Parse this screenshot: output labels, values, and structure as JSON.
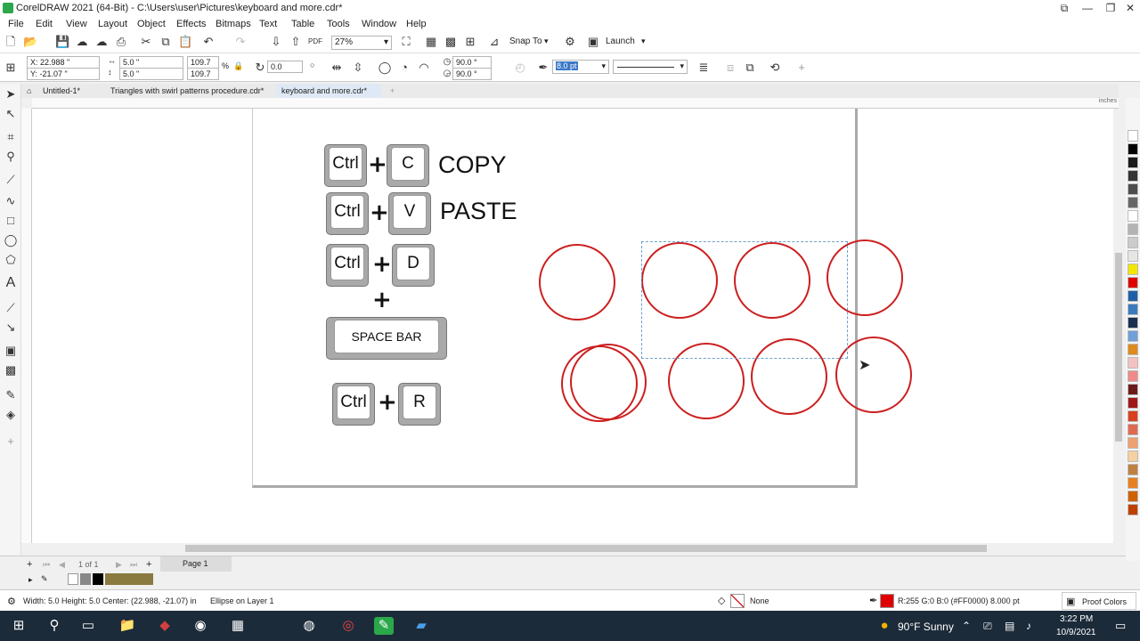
{
  "window": {
    "title": "CorelDRAW 2021 (64-Bit) - C:\\Users\\user\\Pictures\\keyboard and more.cdr*",
    "controls": [
      "—",
      "❐",
      "✕"
    ]
  },
  "menu": [
    "File",
    "Edit",
    "View",
    "Layout",
    "Object",
    "Effects",
    "Bitmaps",
    "Text",
    "Table",
    "Tools",
    "Window",
    "Help"
  ],
  "toolbar": {
    "zoom": "27%",
    "snap_to": "Snap To",
    "launch": "Launch"
  },
  "property_bar": {
    "x": "X: 22.988 \"",
    "y": "Y: -21.07 \"",
    "width": "5.0 \"",
    "height": "5.0 \"",
    "scale_w": "109.7",
    "scale_h": "109.7",
    "percent": "%",
    "rotation": "0.0",
    "angle_start": "90.0 °",
    "angle_end": "90.0 °",
    "outline_width": "8.0 pt"
  },
  "tabs": [
    {
      "label": "Untitled-1*"
    },
    {
      "label": "Triangles with swirl patterns procedure.cdr*"
    },
    {
      "label": "keyboard and more.cdr*"
    }
  ],
  "ruler_unit": "inches",
  "drawing": {
    "copy": {
      "key1": "Ctrl",
      "key2": "C",
      "label": "COPY"
    },
    "paste": {
      "key1": "Ctrl",
      "key2": "V",
      "label": "PASTE"
    },
    "dup": {
      "key1": "Ctrl",
      "key2": "D"
    },
    "spacebar": "SPACE BAR",
    "repeat": {
      "key1": "Ctrl",
      "key2": "R"
    },
    "plus": "+"
  },
  "page_nav": {
    "count": "1 of 1",
    "page_tab": "Page 1"
  },
  "status": {
    "dimensions": "Width: 5.0  Height: 5.0  Center: (22.988, -21.07)  in",
    "object": "Ellipse on Layer 1",
    "fill": "None",
    "outline": "R:255 G:0 B:0 (#FF0000)  8.000 pt",
    "proof": "Proof Colors"
  },
  "taskbar": {
    "weather": "90°F  Sunny",
    "time": "3:22 PM",
    "date": "10/9/2021"
  },
  "palette_colors": [
    "#ffffff",
    "#000000",
    "#1a1a1a",
    "#333333",
    "#4d4d4d",
    "#666666",
    "#ffffff",
    "#b3b3b3",
    "#cccccc",
    "#e6e6e6",
    "#f2e600",
    "#e00000",
    "#1f5fa8",
    "#3a7bbf",
    "#1a2f4f",
    "#6fa0d8",
    "#e08a1e",
    "#f4c2c2",
    "#f08a8a",
    "#6b1a1a",
    "#a01818",
    "#d84020",
    "#e06a50",
    "#f0a070",
    "#f5d0a0",
    "#c08040",
    "#e88020",
    "#d06000",
    "#c04000"
  ],
  "accent_colors": {
    "circle_stroke": "#cc1f1f",
    "selection": "#2a6fb0",
    "taskbar": "#1c2b3a"
  }
}
